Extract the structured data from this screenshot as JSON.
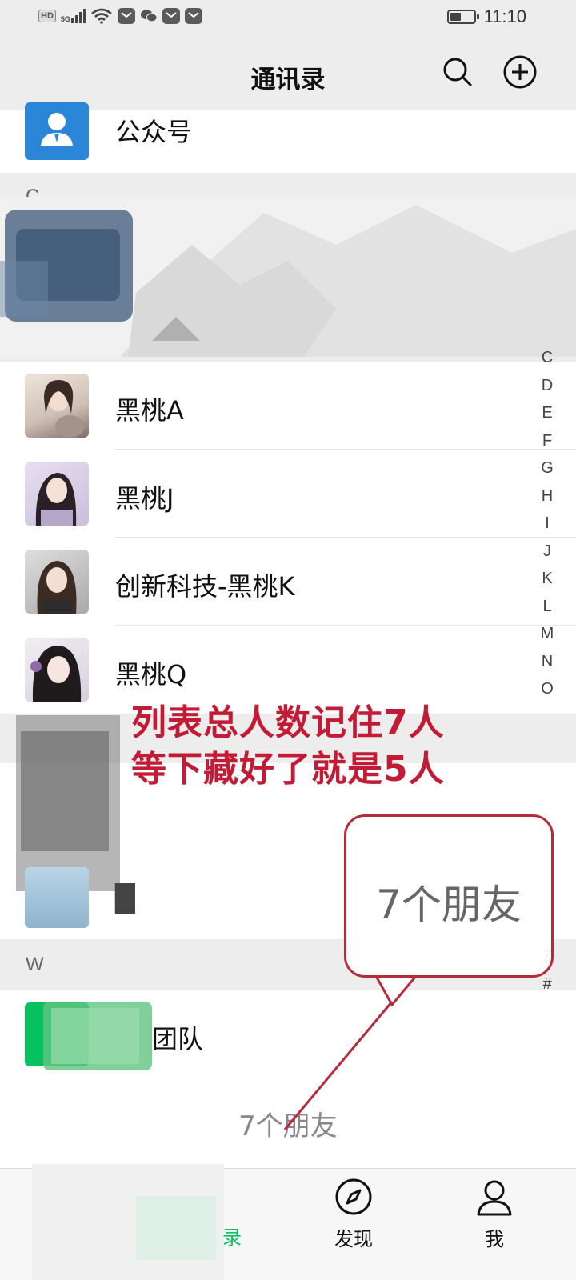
{
  "status_bar": {
    "network_badge": "HD",
    "network_type": "5G",
    "time": "11:10",
    "battery_level": 0.45
  },
  "header": {
    "title": "通讯录",
    "search_icon": "search-icon",
    "add_icon": "plus-circle-icon"
  },
  "list": {
    "official_accounts": "公众号",
    "sections": [
      {
        "letter": "C"
      },
      {
        "letter": "W"
      }
    ],
    "contacts": [
      {
        "name": "黑桃A"
      },
      {
        "name": "黑桃J"
      },
      {
        "name": "创新科技-黑桃K"
      },
      {
        "name": "黑桃Q"
      },
      {
        "name": "团队",
        "partial": true
      }
    ],
    "friend_count": "7个朋友"
  },
  "index_bar": [
    "C",
    "D",
    "E",
    "F",
    "G",
    "H",
    "I",
    "J",
    "K",
    "L",
    "M",
    "N",
    "O",
    "Z",
    "#"
  ],
  "tab_bar": {
    "tabs": [
      {
        "label": "录",
        "active": true
      },
      {
        "label": "发现"
      },
      {
        "label": "我"
      }
    ]
  },
  "annotation": {
    "line1": "列表总人数记住7人",
    "line2": "等下藏好了就是5人",
    "callout": "7个朋友"
  },
  "colors": {
    "accent_green": "#07c160",
    "annotation_red": "#c21b35",
    "official_blue": "#2b86d8"
  }
}
